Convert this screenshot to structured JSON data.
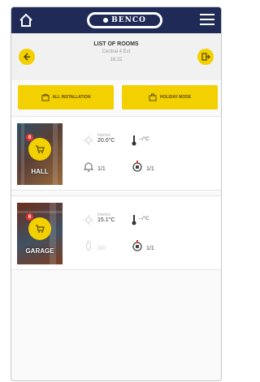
{
  "app": {
    "brand": "BENCO"
  },
  "header": {
    "title": "LIST OF ROOMS",
    "subtitle": "Central 4 Ext",
    "time": "16:22"
  },
  "actions": {
    "all_installation": "ALL INSTALLATION",
    "holiday_mode": "HOLIDAY MODE"
  },
  "rooms": [
    {
      "name": "HALL",
      "badge": "8",
      "temp_label": "Interior",
      "temp_value": "20.0°C",
      "setpoint": "--/°C",
      "alarm_count": "1/1",
      "device_count": "1/1"
    },
    {
      "name": "GARAGE",
      "badge": "8",
      "temp_label": "Interior",
      "temp_value": "15.1°C",
      "setpoint": "--/°C",
      "alarm_count": "0/0",
      "device_count": "1/1"
    }
  ],
  "colors": {
    "topbar": "#1f2a57",
    "accent": "#f3d000",
    "badge": "#e5322d"
  }
}
